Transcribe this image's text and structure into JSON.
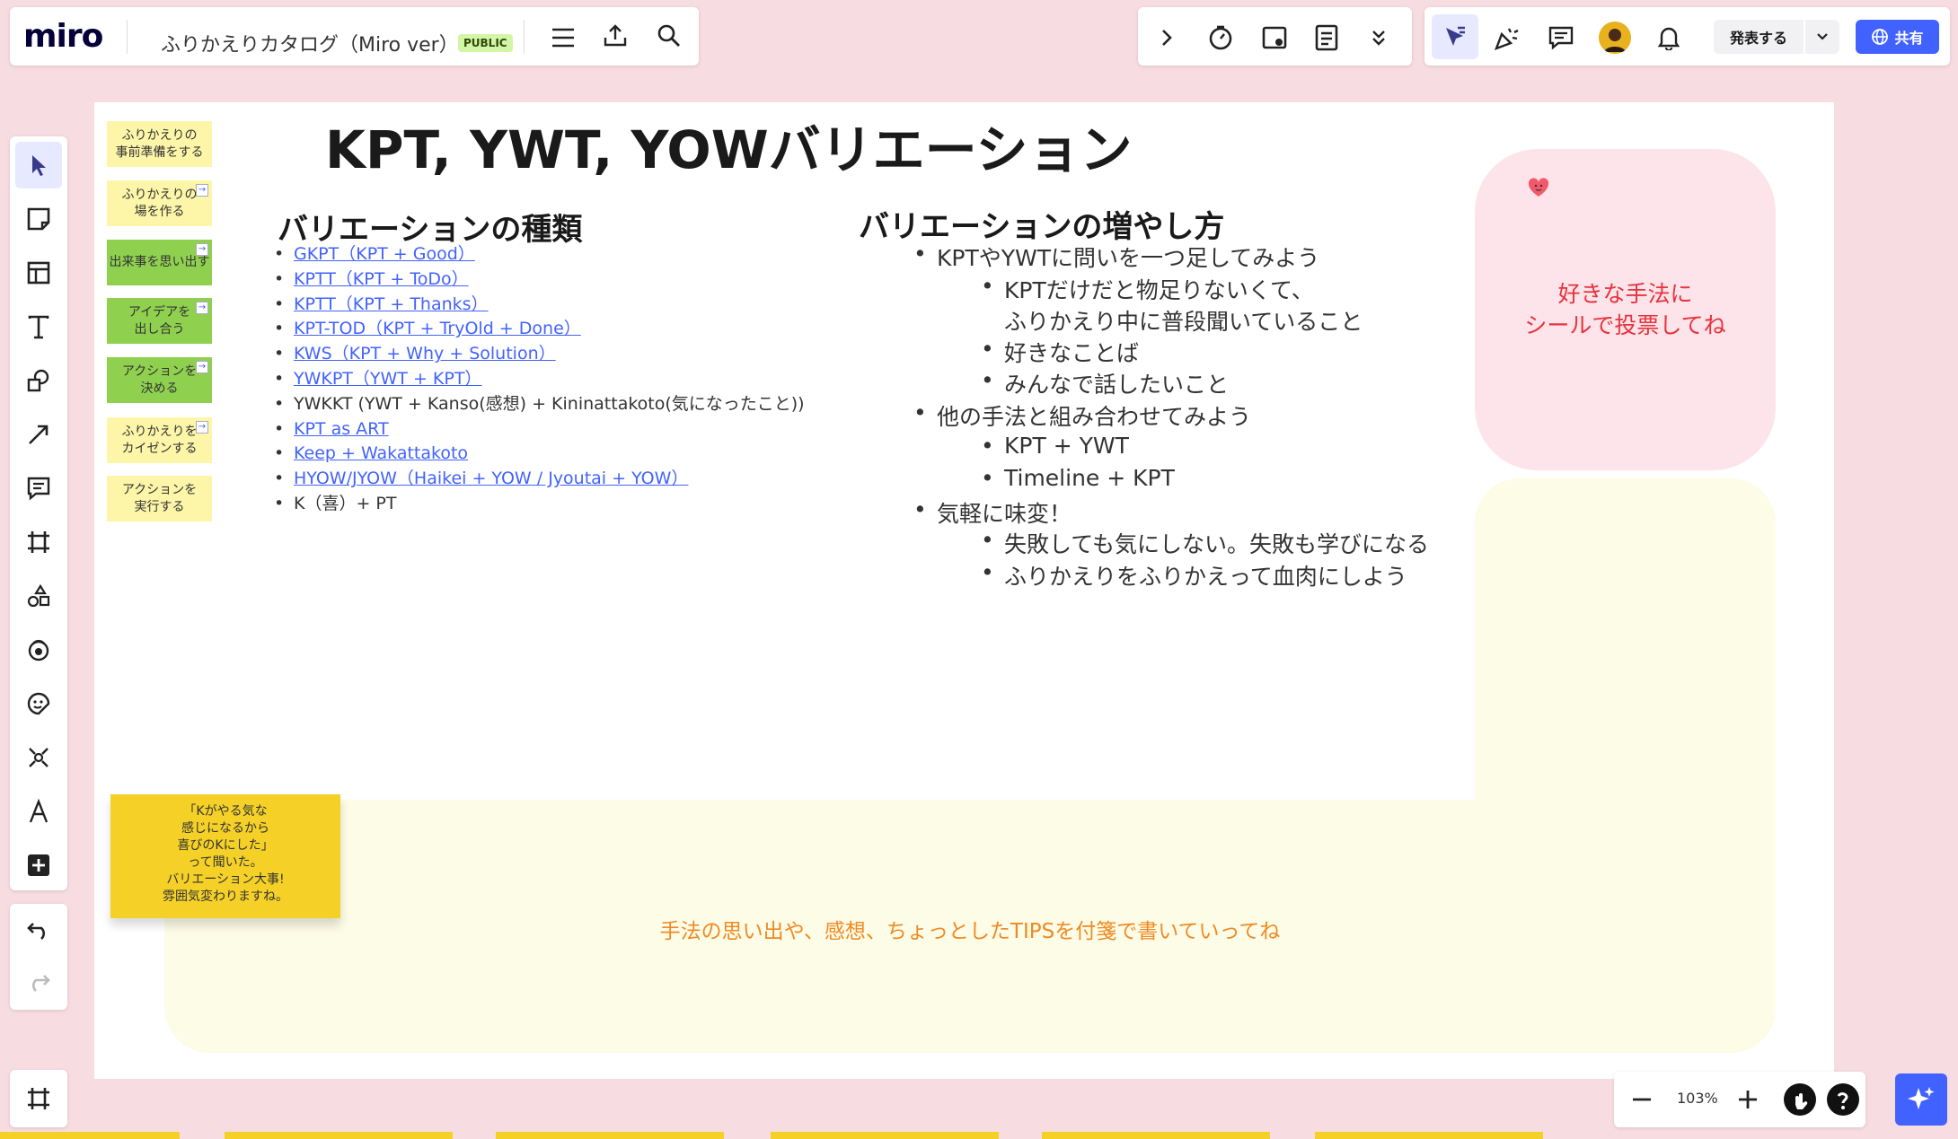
{
  "app": {
    "logo": "miro",
    "board_title": "ふりかえりカタログ（Miro ver）",
    "public_badge": "PUBLIC"
  },
  "top_right": {
    "present_label": "発表する",
    "share_label": "共有"
  },
  "board": {
    "title": "KPT, YWT, YOWバリエーション",
    "side_notes": [
      {
        "text": "ふりかえりの\n事前準備をする",
        "color": "yellow",
        "link": false
      },
      {
        "text": "ふりかえりの\n場を作る",
        "color": "yellow",
        "link": true
      },
      {
        "text": "出来事を思い出す",
        "color": "green",
        "link": true
      },
      {
        "text": "アイデアを\n出し合う",
        "color": "green",
        "link": true
      },
      {
        "text": "アクションを\n決める",
        "color": "green",
        "link": true
      },
      {
        "text": "ふりかえりを\nカイゼンする",
        "color": "yellow",
        "link": true
      },
      {
        "text": "アクションを\n実行する",
        "color": "yellow",
        "link": false
      }
    ],
    "variations": {
      "heading": "バリエーションの種類",
      "items": [
        {
          "text": "GKPT（KPT + Good）",
          "link": true
        },
        {
          "text": "KPTT（KPT + ToDo）",
          "link": true
        },
        {
          "text": "KPTT（KPT + Thanks）",
          "link": true
        },
        {
          "text": "KPT-TOD（KPT + TryOld + Done）",
          "link": true
        },
        {
          "text": "KWS（KPT + Why + Solution）",
          "link": true
        },
        {
          "text": "YWKPT（YWT + KPT）",
          "link": true
        },
        {
          "text": "YWKKT (YWT + Kanso(感想) + Kininattakoto(気になったこと))",
          "link": false
        },
        {
          "text": "KPT as ART",
          "link": true
        },
        {
          "text": "Keep + Wakattakoto",
          "link": true
        },
        {
          "text": "HYOW/JYOW（Haikei + YOW / Jyoutai + YOW）",
          "link": true
        },
        {
          "text": "K（喜）+ PT",
          "link": false
        }
      ]
    },
    "howto": {
      "heading": "バリエーションの増やし方",
      "b1": "KPTやYWTに問いを一つ足してみよう",
      "b1_1": "KPTだけだと物足りないくて、",
      "b1_1b": "ふりかえり中に普段聞いていること",
      "b1_2": "好きなことば",
      "b1_3": "みんなで話したいこと",
      "b2": "他の手法と組み合わせてみよう",
      "b2_1": "KPT + YWT",
      "b2_2": "Timeline + KPT",
      "b3": "気軽に味変！",
      "b3_1": "失敗しても気にしない。失敗も学びになる",
      "b3_2": "ふりかえりをふりかえって血肉にしよう"
    },
    "vote_text_1": "好きな手法に",
    "vote_text_2": "シールで投票してね",
    "tips_text": "手法の思い出や、感想、ちょっとしたTIPSを付箋で書いていってね",
    "sticky_note": "「Kがやる気な\n感じになるから\n喜びのKにした」\nって聞いた。\nバリエーション大事!\n雰囲気変わりますね。"
  },
  "zoom": {
    "value": "103%"
  },
  "colors": {
    "accent": "#4262ff",
    "canvas_bg": "#f7dde1",
    "green_note": "#8fd14f",
    "yellow_note": "#fdf6a8",
    "sticky": "#f5d128",
    "vote_text": "#e8323c",
    "tips_text": "#f08a24"
  }
}
